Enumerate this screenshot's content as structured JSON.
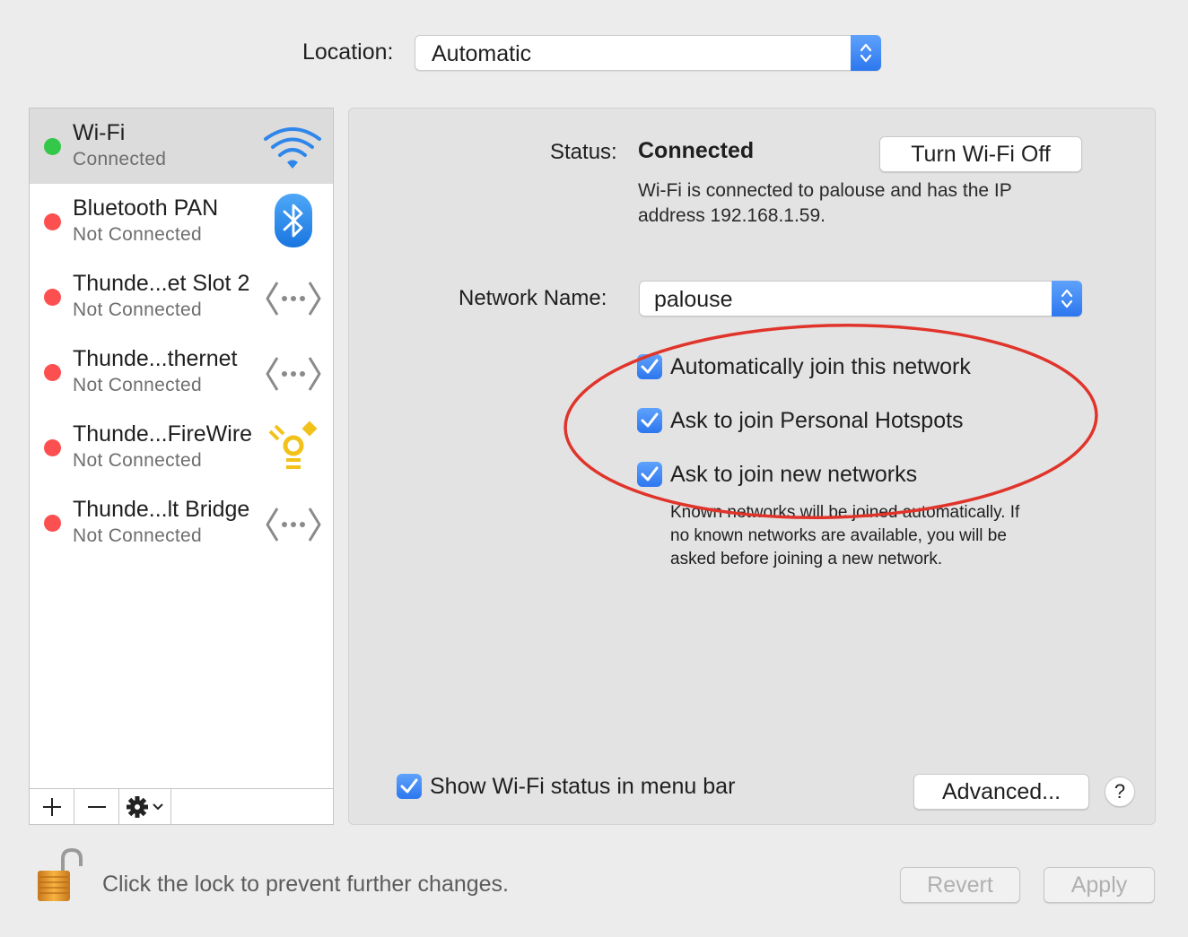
{
  "location": {
    "label": "Location:",
    "value": "Automatic"
  },
  "services": [
    {
      "name": "Wi-Fi",
      "status": "Connected",
      "status_color": "#34c84a",
      "icon": "wifi-icon",
      "selected": true
    },
    {
      "name": "Bluetooth PAN",
      "status": "Not Connected",
      "status_color": "#fc4f4f",
      "icon": "bluetooth-icon"
    },
    {
      "name": "Thunde...et Slot 2",
      "status": "Not Connected",
      "status_color": "#fc4f4f",
      "icon": "ethernet-icon"
    },
    {
      "name": "Thunde...thernet",
      "status": "Not Connected",
      "status_color": "#fc4f4f",
      "icon": "ethernet-icon"
    },
    {
      "name": "Thunde...FireWire",
      "status": "Not Connected",
      "status_color": "#fc4f4f",
      "icon": "firewire-icon"
    },
    {
      "name": "Thunde...lt Bridge",
      "status": "Not Connected",
      "status_color": "#fc4f4f",
      "icon": "ethernet-icon"
    }
  ],
  "toolbar": {
    "add": "+",
    "remove": "—"
  },
  "panel": {
    "status_label": "Status:",
    "status_value": "Connected",
    "turn_off_button": "Turn Wi-Fi Off",
    "status_desc_line1": "Wi-Fi is connected to palouse and has the IP",
    "status_desc_line2": "address 192.168.1.59.",
    "network_name_label": "Network Name:",
    "network_name_value": "palouse",
    "options": [
      {
        "label": "Automatically join this network",
        "checked": true
      },
      {
        "label": "Ask to join Personal Hotspots",
        "checked": true
      },
      {
        "label": "Ask to join new networks",
        "checked": true
      }
    ],
    "info_line1": "Known networks will be joined automatically. If",
    "info_line2": "no known networks are available, you will be",
    "info_line3": "asked before joining a new network.",
    "show_status_label": "Show Wi-Fi status in menu bar",
    "show_status_checked": true,
    "advanced_button": "Advanced...",
    "help_button": "?"
  },
  "footer": {
    "lock_text": "Click the lock to prevent further changes.",
    "revert_button": "Revert",
    "apply_button": "Apply"
  },
  "colors": {
    "accent": "#2d77ef",
    "annotation": "#e0342b"
  }
}
